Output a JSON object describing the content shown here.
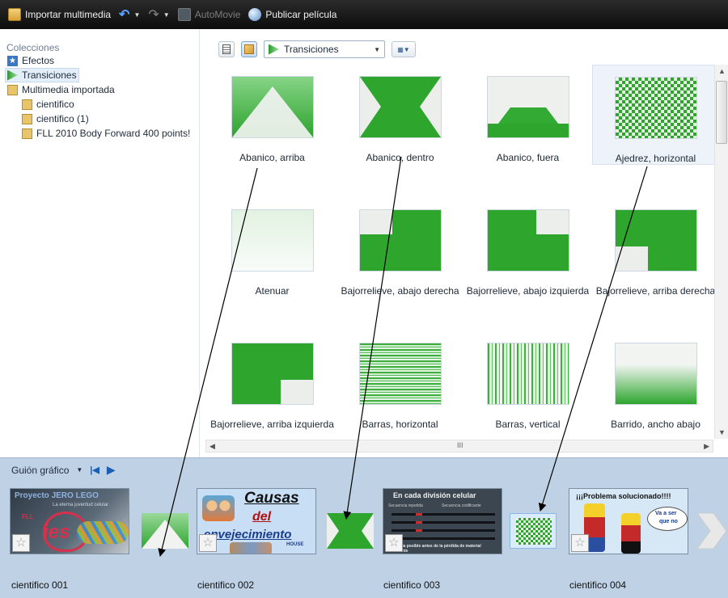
{
  "toolbar": {
    "import_label": "Importar multimedia",
    "automovie_label": "AutoMovie",
    "publish_label": "Publicar película"
  },
  "sidebar": {
    "heading": "Colecciones",
    "items": [
      {
        "label": "Efectos",
        "icon": "star-effects-icon"
      },
      {
        "label": "Transiciones",
        "icon": "transition-icon"
      },
      {
        "label": "Multimedia importada",
        "icon": "media-folder-icon"
      },
      {
        "label": "cientifico",
        "icon": "media-folder-icon"
      },
      {
        "label": "cientifico (1)",
        "icon": "media-folder-icon"
      },
      {
        "label": "FLL 2010 Body Forward 400 points!",
        "icon": "media-folder-icon"
      }
    ]
  },
  "content": {
    "category_select": "Transiciones",
    "transitions": [
      {
        "label": "Abanico, arriba",
        "pattern": "fan-up"
      },
      {
        "label": "Abanico, dentro",
        "pattern": "fan-in"
      },
      {
        "label": "Abanico, fuera",
        "pattern": "fan-out"
      },
      {
        "label": "Ajedrez, horizontal",
        "pattern": "checker"
      },
      {
        "label": "Atenuar",
        "pattern": "fade"
      },
      {
        "label": "Bajorrelieve, abajo derecha",
        "pattern": "emboss-br"
      },
      {
        "label": "Bajorrelieve, abajo izquierda",
        "pattern": "emboss-bl"
      },
      {
        "label": "Bajorrelieve, arriba derecha",
        "pattern": "emboss-tr"
      },
      {
        "label": "Bajorrelieve, arriba izquierda",
        "pattern": "emboss-tl"
      },
      {
        "label": "Barras, horizontal",
        "pattern": "bars-h"
      },
      {
        "label": "Barras, vertical",
        "pattern": "bars-v"
      },
      {
        "label": "Barrido, ancho abajo",
        "pattern": "sweep"
      }
    ],
    "hscroll_grip": "III"
  },
  "storyboard": {
    "label": "Guión gráfico",
    "clips": [
      {
        "label": "cientifico 001",
        "title": "Proyecto JERO LEGO",
        "subtitle": "La eterna juventud celular",
        "word": "ies",
        "footer": "FLL"
      },
      {
        "label": "cientifico 002",
        "title1": "Causas",
        "title2": "del",
        "title3": "envejecimiento",
        "badge": "HOUSE"
      },
      {
        "label": "cientifico 003",
        "title": "En cada división celular",
        "col1": "Secuencia repetida",
        "col2": "Secuencia codificante",
        "note": "una copia posible antes de la pérdida de material codificante"
      },
      {
        "label": "cientifico 004",
        "title": "¡¡¡Problema solucionado!!!!",
        "bubble1": "Va a ser",
        "bubble2": "que no"
      }
    ]
  }
}
